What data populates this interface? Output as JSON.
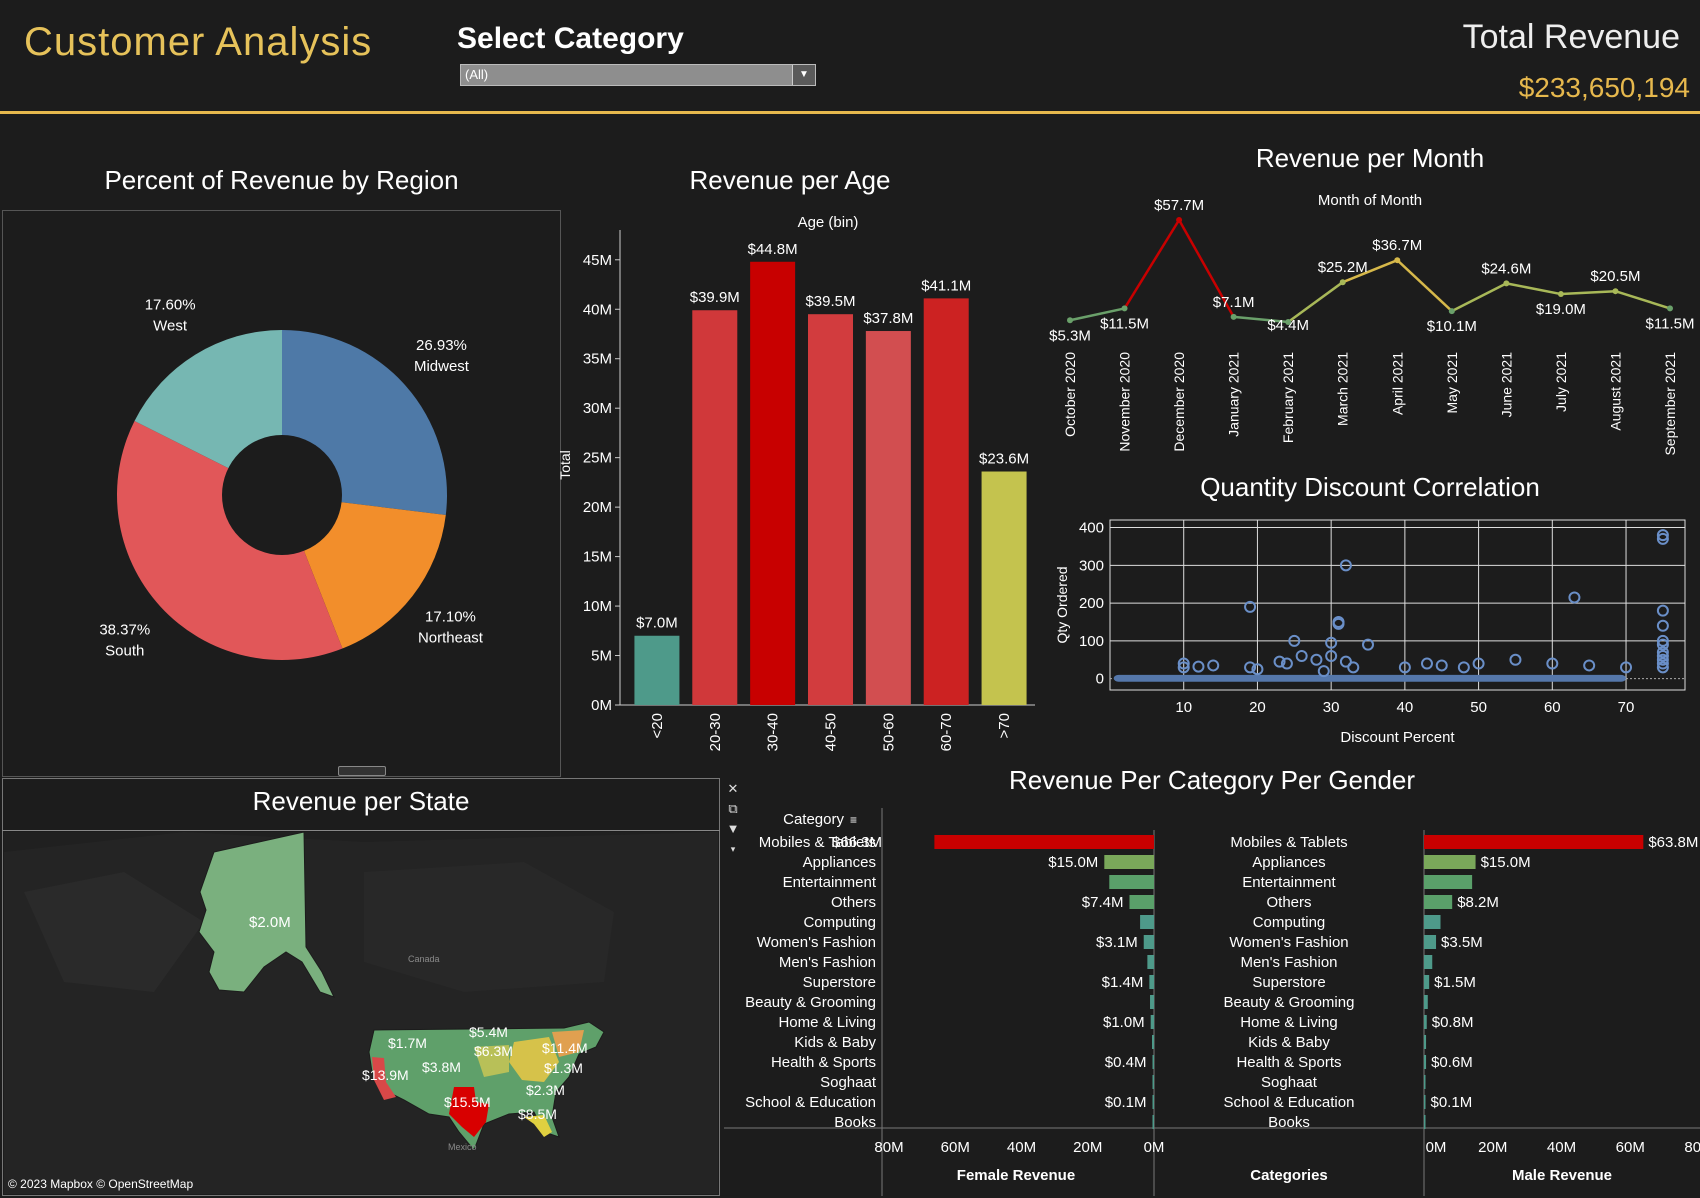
{
  "header": {
    "title": "Customer Analysis",
    "select_label": "Select Category",
    "select_value": "(All)",
    "total_revenue_label": "Total Revenue",
    "total_revenue_value": "$233,650,194",
    "accent_color": "#e6b84d"
  },
  "pie": {
    "title": "Percent of Revenue by Region",
    "slices": [
      {
        "region": "Midwest",
        "pct": 26.93,
        "label": "26.93%",
        "color": "#4e79a7"
      },
      {
        "region": "Northeast",
        "pct": 17.1,
        "label": "17.10%",
        "color": "#f28e2b"
      },
      {
        "region": "South",
        "pct": 38.37,
        "label": "38.37%",
        "color": "#e15759"
      },
      {
        "region": "West",
        "pct": 17.6,
        "label": "17.60%",
        "color": "#76b7b2"
      }
    ]
  },
  "age": {
    "title": "Revenue per Age",
    "axis_title": "Age (bin)",
    "ylabel": "Total",
    "yticks": [
      "0M",
      "5M",
      "10M",
      "15M",
      "20M",
      "25M",
      "30M",
      "35M",
      "40M",
      "45M"
    ],
    "ylim": [
      0,
      47
    ],
    "bars": [
      {
        "bin": "<20",
        "value": 7.0,
        "label": "$7.0M",
        "color": "#4e9a8a"
      },
      {
        "bin": "20-30",
        "value": 39.9,
        "label": "$39.9M",
        "color": "#d0383a"
      },
      {
        "bin": "30-40",
        "value": 44.8,
        "label": "$44.8M",
        "color": "#c80000"
      },
      {
        "bin": "40-50",
        "value": 39.5,
        "label": "$39.5M",
        "color": "#d23c3e"
      },
      {
        "bin": "50-60",
        "value": 37.8,
        "label": "$37.8M",
        "color": "#d24e50"
      },
      {
        "bin": "60-70",
        "value": 41.1,
        "label": "$41.1M",
        "color": "#cc2222"
      },
      {
        "bin": ">70",
        "value": 23.6,
        "label": "$23.6M",
        "color": "#c4c34e"
      }
    ]
  },
  "month": {
    "title": "Revenue per Month",
    "axis_title": "Month of Month",
    "points": [
      {
        "month": "October 2020",
        "value": 5.3,
        "label": "$5.3M"
      },
      {
        "month": "November 2020",
        "value": 11.5,
        "label": "$11.5M"
      },
      {
        "month": "December 2020",
        "value": 57.7,
        "label": "$57.7M"
      },
      {
        "month": "January 2021",
        "value": 7.1,
        "label": "$7.1M"
      },
      {
        "month": "February 2021",
        "value": 4.4,
        "label": "$4.4M"
      },
      {
        "month": "March 2021",
        "value": 25.2,
        "label": "$25.2M"
      },
      {
        "month": "April 2021",
        "value": 36.7,
        "label": "$36.7M"
      },
      {
        "month": "May 2021",
        "value": 10.1,
        "label": "$10.1M"
      },
      {
        "month": "June 2021",
        "value": 24.6,
        "label": "$24.6M"
      },
      {
        "month": "July 2021",
        "value": 19.0,
        "label": "$19.0M"
      },
      {
        "month": "August 2021",
        "value": 20.5,
        "label": "$20.5M"
      },
      {
        "month": "September 2021",
        "value": 11.5,
        "label": "$11.5M"
      }
    ]
  },
  "scatter": {
    "title": "Quantity Discount Correlation",
    "xlabel": "Discount Percent",
    "ylabel": "Qty Ordered",
    "xticks": [
      10,
      20,
      30,
      40,
      50,
      60,
      70
    ],
    "yticks": [
      0,
      100,
      200,
      300,
      400
    ],
    "xlim": [
      0,
      78
    ],
    "ylim": [
      -30,
      420
    ],
    "outliers": [
      [
        10,
        40
      ],
      [
        10,
        30
      ],
      [
        12,
        32
      ],
      [
        14,
        35
      ],
      [
        19,
        190
      ],
      [
        19,
        30
      ],
      [
        20,
        25
      ],
      [
        23,
        45
      ],
      [
        24,
        40
      ],
      [
        25,
        100
      ],
      [
        26,
        60
      ],
      [
        28,
        50
      ],
      [
        29,
        20
      ],
      [
        30,
        60
      ],
      [
        30,
        95
      ],
      [
        31,
        150
      ],
      [
        31,
        145
      ],
      [
        32,
        300
      ],
      [
        32,
        45
      ],
      [
        33,
        30
      ],
      [
        35,
        90
      ],
      [
        40,
        30
      ],
      [
        43,
        40
      ],
      [
        45,
        35
      ],
      [
        48,
        30
      ],
      [
        50,
        40
      ],
      [
        55,
        50
      ],
      [
        60,
        40
      ],
      [
        63,
        215
      ],
      [
        65,
        35
      ],
      [
        70,
        30
      ],
      [
        75,
        380
      ],
      [
        75,
        370
      ],
      [
        75,
        180
      ],
      [
        75,
        140
      ],
      [
        75,
        100
      ],
      [
        75,
        90
      ],
      [
        75,
        70
      ],
      [
        75,
        60
      ],
      [
        75,
        50
      ],
      [
        75,
        40
      ],
      [
        75,
        30
      ]
    ]
  },
  "category": {
    "title": "Revenue Per Category Per Gender",
    "header": "Category",
    "female_axis_title": "Female Revenue",
    "male_axis_title": "Male Revenue",
    "center_axis_title": "Categories",
    "female_ticks": [
      "80M",
      "60M",
      "40M",
      "20M",
      "0M"
    ],
    "male_ticks": [
      "0M",
      "20M",
      "40M",
      "60M",
      "80M"
    ],
    "xmax": 80,
    "rows": [
      {
        "name": "Mobiles & Tablets",
        "female": 66.3,
        "female_label": "$66.3M",
        "male": 63.8,
        "male_label": "$63.8M",
        "color": "#c80000"
      },
      {
        "name": "Appliances",
        "female": 15.0,
        "female_label": "$15.0M",
        "male": 15.0,
        "male_label": "$15.0M",
        "color": "#7aa85a"
      },
      {
        "name": "Entertainment",
        "female": 13.5,
        "female_label": "",
        "male": 14.0,
        "male_label": "",
        "color": "#5aa06a"
      },
      {
        "name": "Others",
        "female": 7.4,
        "female_label": "$7.4M",
        "male": 8.2,
        "male_label": "$8.2M",
        "color": "#5aa06a"
      },
      {
        "name": "Computing",
        "female": 4.2,
        "female_label": "",
        "male": 4.8,
        "male_label": "",
        "color": "#4e9a8a"
      },
      {
        "name": "Women's Fashion",
        "female": 3.1,
        "female_label": "$3.1M",
        "male": 3.5,
        "male_label": "$3.5M",
        "color": "#4e9a8a"
      },
      {
        "name": "Men's Fashion",
        "female": 2.0,
        "female_label": "",
        "male": 2.4,
        "male_label": "",
        "color": "#4e9a8a"
      },
      {
        "name": "Superstore",
        "female": 1.4,
        "female_label": "$1.4M",
        "male": 1.5,
        "male_label": "$1.5M",
        "color": "#4e9a8a"
      },
      {
        "name": "Beauty & Grooming",
        "female": 1.2,
        "female_label": "",
        "male": 1.1,
        "male_label": "",
        "color": "#4e9a8a"
      },
      {
        "name": "Home & Living",
        "female": 1.0,
        "female_label": "$1.0M",
        "male": 0.8,
        "male_label": "$0.8M",
        "color": "#4e9a8a"
      },
      {
        "name": "Kids & Baby",
        "female": 0.6,
        "female_label": "",
        "male": 0.6,
        "male_label": "",
        "color": "#4e9a8a"
      },
      {
        "name": "Health & Sports",
        "female": 0.4,
        "female_label": "$0.4M",
        "male": 0.6,
        "male_label": "$0.6M",
        "color": "#4e9a8a"
      },
      {
        "name": "Soghaat",
        "female": 0.2,
        "female_label": "",
        "male": 0.2,
        "male_label": "",
        "color": "#4e9a8a"
      },
      {
        "name": "School & Education",
        "female": 0.1,
        "female_label": "$0.1M",
        "male": 0.1,
        "male_label": "$0.1M",
        "color": "#4e9a8a"
      },
      {
        "name": "Books",
        "female": 0.05,
        "female_label": "",
        "male": 0.05,
        "male_label": "",
        "color": "#4e9a8a"
      }
    ]
  },
  "map": {
    "title": "Revenue per State",
    "attribution": "© 2023 Mapbox © OpenStreetMap",
    "place_canada": "Canada",
    "place_mexico": "Mexico",
    "labels": [
      "$2.0M",
      "$1.7M",
      "$5.4M",
      "$6.3M",
      "$11.4M",
      "$3.8M",
      "$1.3M",
      "$13.9M",
      "$2.3M",
      "$15.5M",
      "$8.5M"
    ]
  },
  "toolbar": {
    "icons": [
      "close-icon",
      "popout-icon",
      "filter-icon",
      "dropdown-icon"
    ]
  }
}
